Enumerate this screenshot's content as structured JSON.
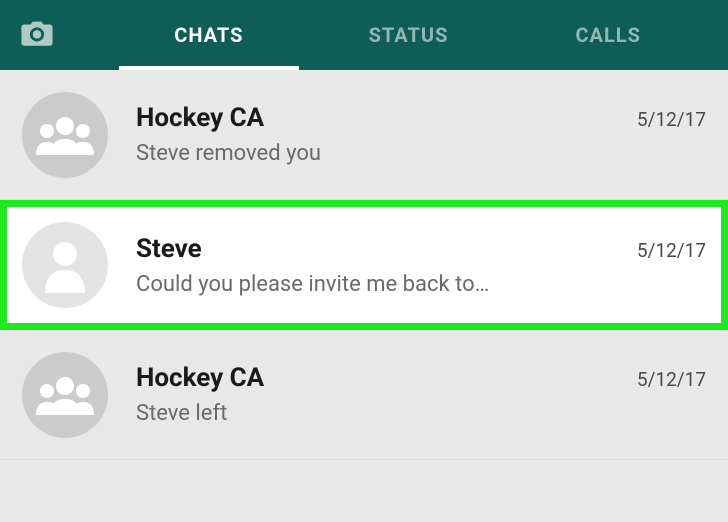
{
  "tabs": {
    "chats": "CHATS",
    "status": "STATUS",
    "calls": "CALLS"
  },
  "chats": [
    {
      "name": "Hockey CA",
      "date": "5/12/17",
      "message": "Steve removed you",
      "avatarType": "group",
      "highlighted": false
    },
    {
      "name": "Steve",
      "date": "5/12/17",
      "message": "Could you please invite me back to…",
      "avatarType": "person",
      "highlighted": true
    },
    {
      "name": "Hockey CA",
      "date": "5/12/17",
      "message": "Steve left",
      "avatarType": "group",
      "highlighted": false
    }
  ]
}
